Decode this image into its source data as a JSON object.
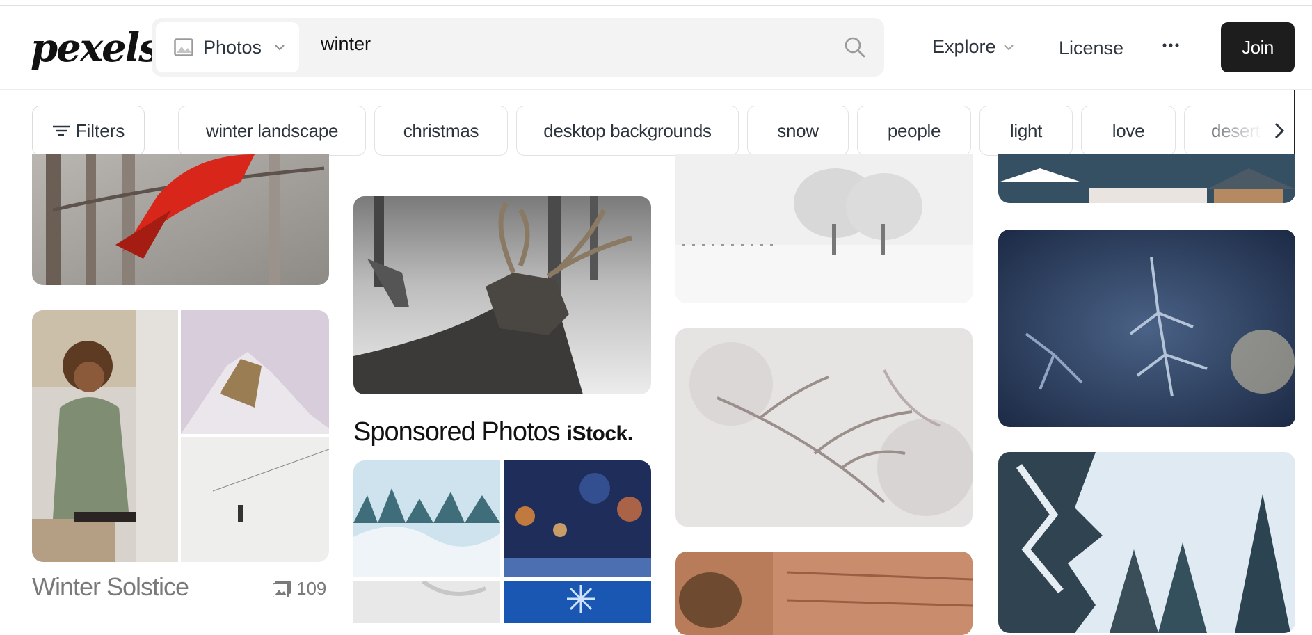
{
  "header": {
    "logo": "pexels",
    "media_type": "Photos",
    "search_value": "winter",
    "nav_explore": "Explore",
    "nav_license": "License",
    "join_label": "Join"
  },
  "filters": {
    "filters_label": "Filters",
    "chips": [
      "winter landscape",
      "christmas",
      "desktop backgrounds",
      "snow",
      "people",
      "light",
      "love",
      "desert"
    ]
  },
  "collection": {
    "title": "Winter Solstice",
    "count": "109"
  },
  "sponsored": {
    "label": "Sponsored Photos",
    "brand": "iStock."
  },
  "icons": [
    "image-icon",
    "chevron-down-icon",
    "search-icon",
    "more-icon",
    "filter-icon",
    "chevron-right-icon",
    "collection-icon"
  ]
}
